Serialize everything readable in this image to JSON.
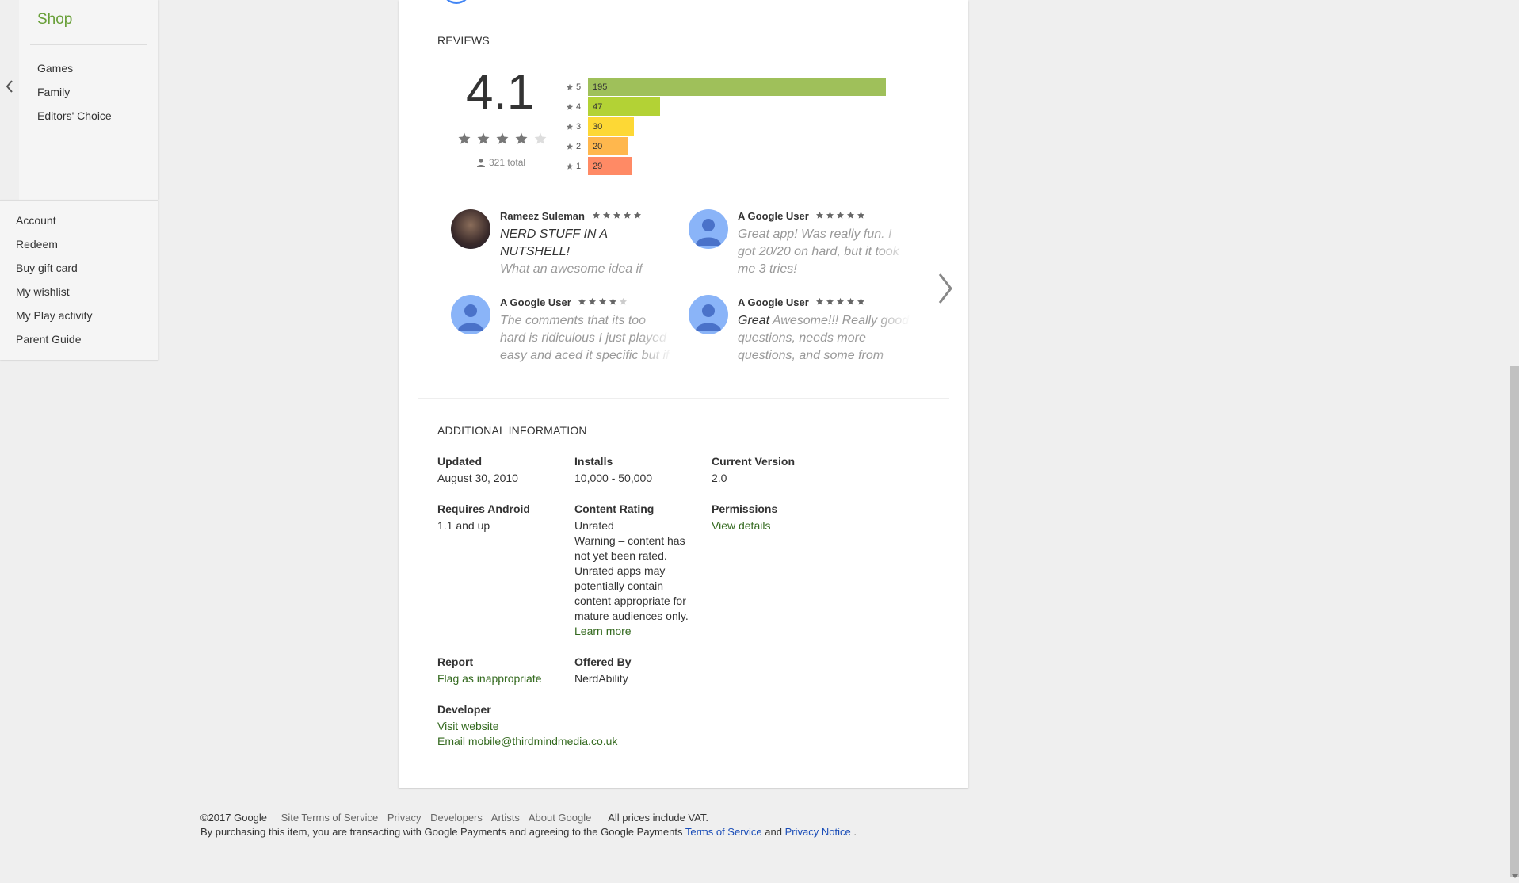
{
  "sidebar": {
    "brand": "Shop",
    "categories": [
      "Games",
      "Family",
      "Editors' Choice"
    ],
    "account_links": [
      "Account",
      "Redeem",
      "Buy gift card",
      "My wishlist",
      "My Play activity",
      "Parent Guide"
    ]
  },
  "reviews": {
    "heading": "REVIEWS",
    "average": "4.1",
    "average_stars": 4,
    "total": "321 total",
    "histogram": [
      {
        "star": "5",
        "count": "195",
        "value": 195,
        "color": "#9fc05a"
      },
      {
        "star": "4",
        "count": "47",
        "value": 47,
        "color": "#b3d235"
      },
      {
        "star": "3",
        "count": "30",
        "value": 30,
        "color": "#fdd835"
      },
      {
        "star": "2",
        "count": "20",
        "value": 20,
        "color": "#ffb74d"
      },
      {
        "star": "1",
        "count": "29",
        "value": 29,
        "color": "#ff8a65"
      }
    ],
    "items": [
      {
        "author": "Rameez Suleman",
        "stars": 5,
        "title": "NERD STUFF IN A NUTSHELL!",
        "text": "What an awesome idea if creating a quiz about CHUCK"
      },
      {
        "author": "A Google User",
        "stars": 5,
        "title": "",
        "text": "Great app! Was really fun. I got 20/20 on hard, but it took me 3 tries!"
      },
      {
        "author": "A Google User",
        "stars": 4,
        "title": "",
        "text": "The comments that its too hard is ridiculous I just played easy and aced it specific but if your a"
      },
      {
        "author": "A Google User",
        "stars": 5,
        "title": "Great",
        "text": "Awesome!!! Really good questions, needs more questions, and some from"
      }
    ]
  },
  "additional": {
    "heading": "ADDITIONAL INFORMATION",
    "updated_label": "Updated",
    "updated": "August 30, 2010",
    "installs_label": "Installs",
    "installs": "10,000 - 50,000",
    "version_label": "Current Version",
    "version": "2.0",
    "android_label": "Requires Android",
    "android": "1.1 and up",
    "content_rating_label": "Content Rating",
    "content_rating": "Unrated",
    "content_rating_warning": "Warning – content has not yet been rated. Unrated apps may potentially contain content appropriate for mature audiences only.",
    "learn_more": "Learn more",
    "permissions_label": "Permissions",
    "permissions_link": "View details",
    "report_label": "Report",
    "report_link": "Flag as inappropriate",
    "offered_label": "Offered By",
    "offered": "NerdAbility",
    "developer_label": "Developer",
    "visit_website": "Visit website",
    "email": "Email mobile@thirdmindmedia.co.uk"
  },
  "footer": {
    "copyright": "©2017 Google",
    "links": [
      "Site Terms of Service",
      "Privacy",
      "Developers",
      "Artists",
      "About Google"
    ],
    "vat": "All prices include VAT.",
    "purchase_text": "By purchasing this item, you are transacting with Google Payments and agreeing to the Google Payments",
    "terms_link": "Terms of Service",
    "and": "and",
    "privacy_link": "Privacy Notice",
    "period": "."
  },
  "colors": {
    "accent_green": "#689f38",
    "link_green": "#33691e",
    "link_blue": "#1a4db8",
    "avatar_blue": "#8ab4f8"
  }
}
